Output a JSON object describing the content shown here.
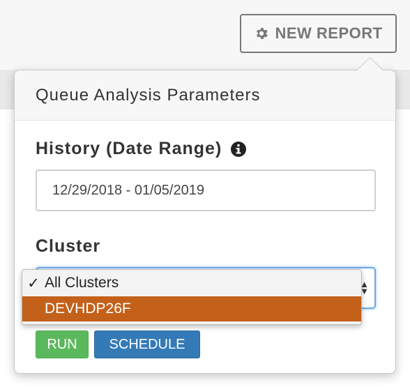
{
  "toolbar": {
    "new_report_label": "NEW REPORT",
    "new_report_icon": "gear-icon"
  },
  "popover": {
    "title": "Queue Analysis Parameters",
    "history": {
      "label": "History (Date Range)",
      "info_icon": "info-icon",
      "value": "12/29/2018 - 01/05/2019"
    },
    "cluster": {
      "label": "Cluster",
      "options": [
        {
          "label": "All Clusters",
          "checked": true
        },
        {
          "label": "DEVHDP26F",
          "highlighted": true
        }
      ],
      "arrows_glyph": "▲▼"
    },
    "buttons": {
      "run": "RUN",
      "schedule": "SCHEDULE"
    }
  },
  "colors": {
    "highlight": "#c3601a",
    "run": "#5cb85c",
    "schedule": "#337ab7",
    "focus": "#6aa6e8"
  }
}
